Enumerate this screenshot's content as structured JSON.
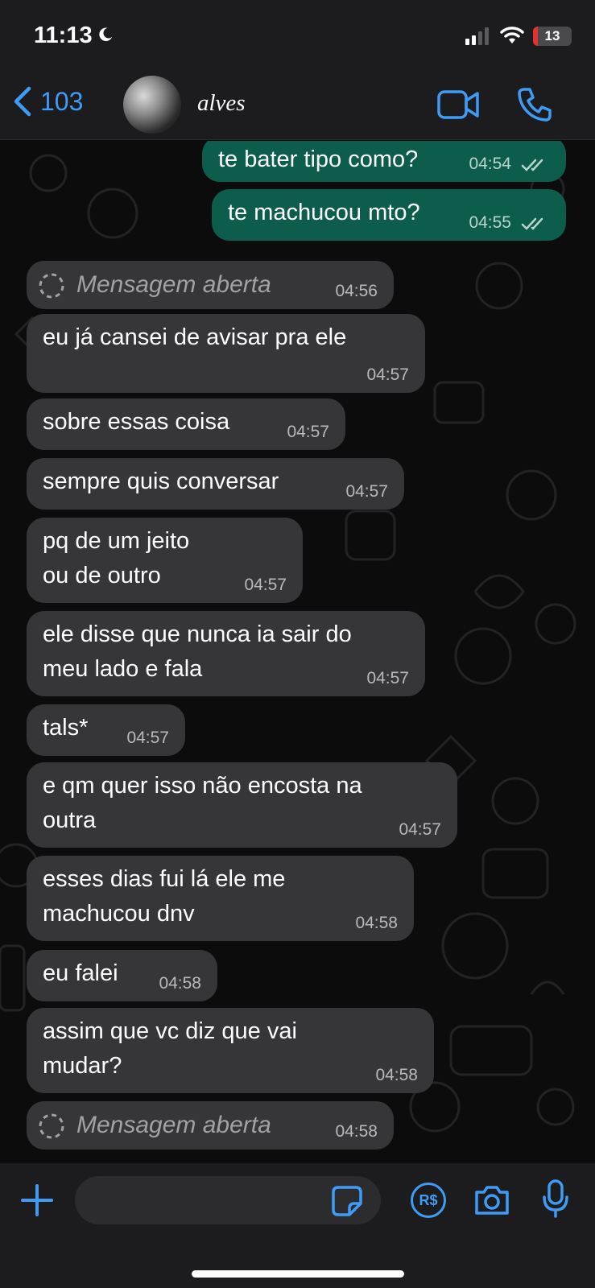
{
  "status_bar": {
    "time": "11:13",
    "battery_level": "13",
    "icons": [
      "moon-icon",
      "signal-icon",
      "wifi-icon",
      "battery-charging-icon"
    ],
    "battery_fraction": 0.13
  },
  "header": {
    "back_count": "103",
    "contact_name": "alves",
    "icons": [
      "chevron-left-icon",
      "video-call-icon",
      "phone-icon"
    ]
  },
  "messages": [
    {
      "dir": "out",
      "text": "te bater tipo como?",
      "time": "04:54",
      "status": "read"
    },
    {
      "dir": "out",
      "text": "te machucou mto?",
      "time": "04:55",
      "status": "read"
    },
    {
      "dir": "in",
      "type": "view-once",
      "text": "Mensagem aberta",
      "time": "04:56"
    },
    {
      "dir": "in",
      "text": "eu já cansei de avisar pra ele",
      "time": "04:57"
    },
    {
      "dir": "in",
      "text": "sobre essas coisa",
      "time": "04:57"
    },
    {
      "dir": "in",
      "text": "sempre quis conversar",
      "time": "04:57"
    },
    {
      "dir": "in",
      "text": "pq de um jeito\nou de outro",
      "time": "04:57"
    },
    {
      "dir": "in",
      "text": "ele disse que nunca ia sair do\nmeu lado e fala",
      "time": "04:57"
    },
    {
      "dir": "in",
      "text": "tals*",
      "time": "04:57"
    },
    {
      "dir": "in",
      "text": "e qm quer isso não encosta na\noutra",
      "time": "04:57"
    },
    {
      "dir": "in",
      "text": "esses dias fui lá ele me\nmachucou dnv",
      "time": "04:58"
    },
    {
      "dir": "in",
      "text": "eu falei",
      "time": "04:58"
    },
    {
      "dir": "in",
      "text": "assim que vc diz que vai\nmudar?",
      "time": "04:58"
    },
    {
      "dir": "in",
      "type": "view-once",
      "text": "Mensagem aberta",
      "time": "04:58"
    }
  ],
  "input_bar": {
    "placeholder": "",
    "icons": [
      "plus-icon",
      "sticker-icon",
      "pay-icon",
      "camera-icon",
      "microphone-icon"
    ],
    "pay_label": "R$"
  },
  "colors": {
    "accent": "#3f9cf6",
    "incoming_bubble": "#363638",
    "outgoing_bubble": "#0d5d4c",
    "bar_background": "#1c1c1e",
    "battery_red": "#e5322d"
  }
}
